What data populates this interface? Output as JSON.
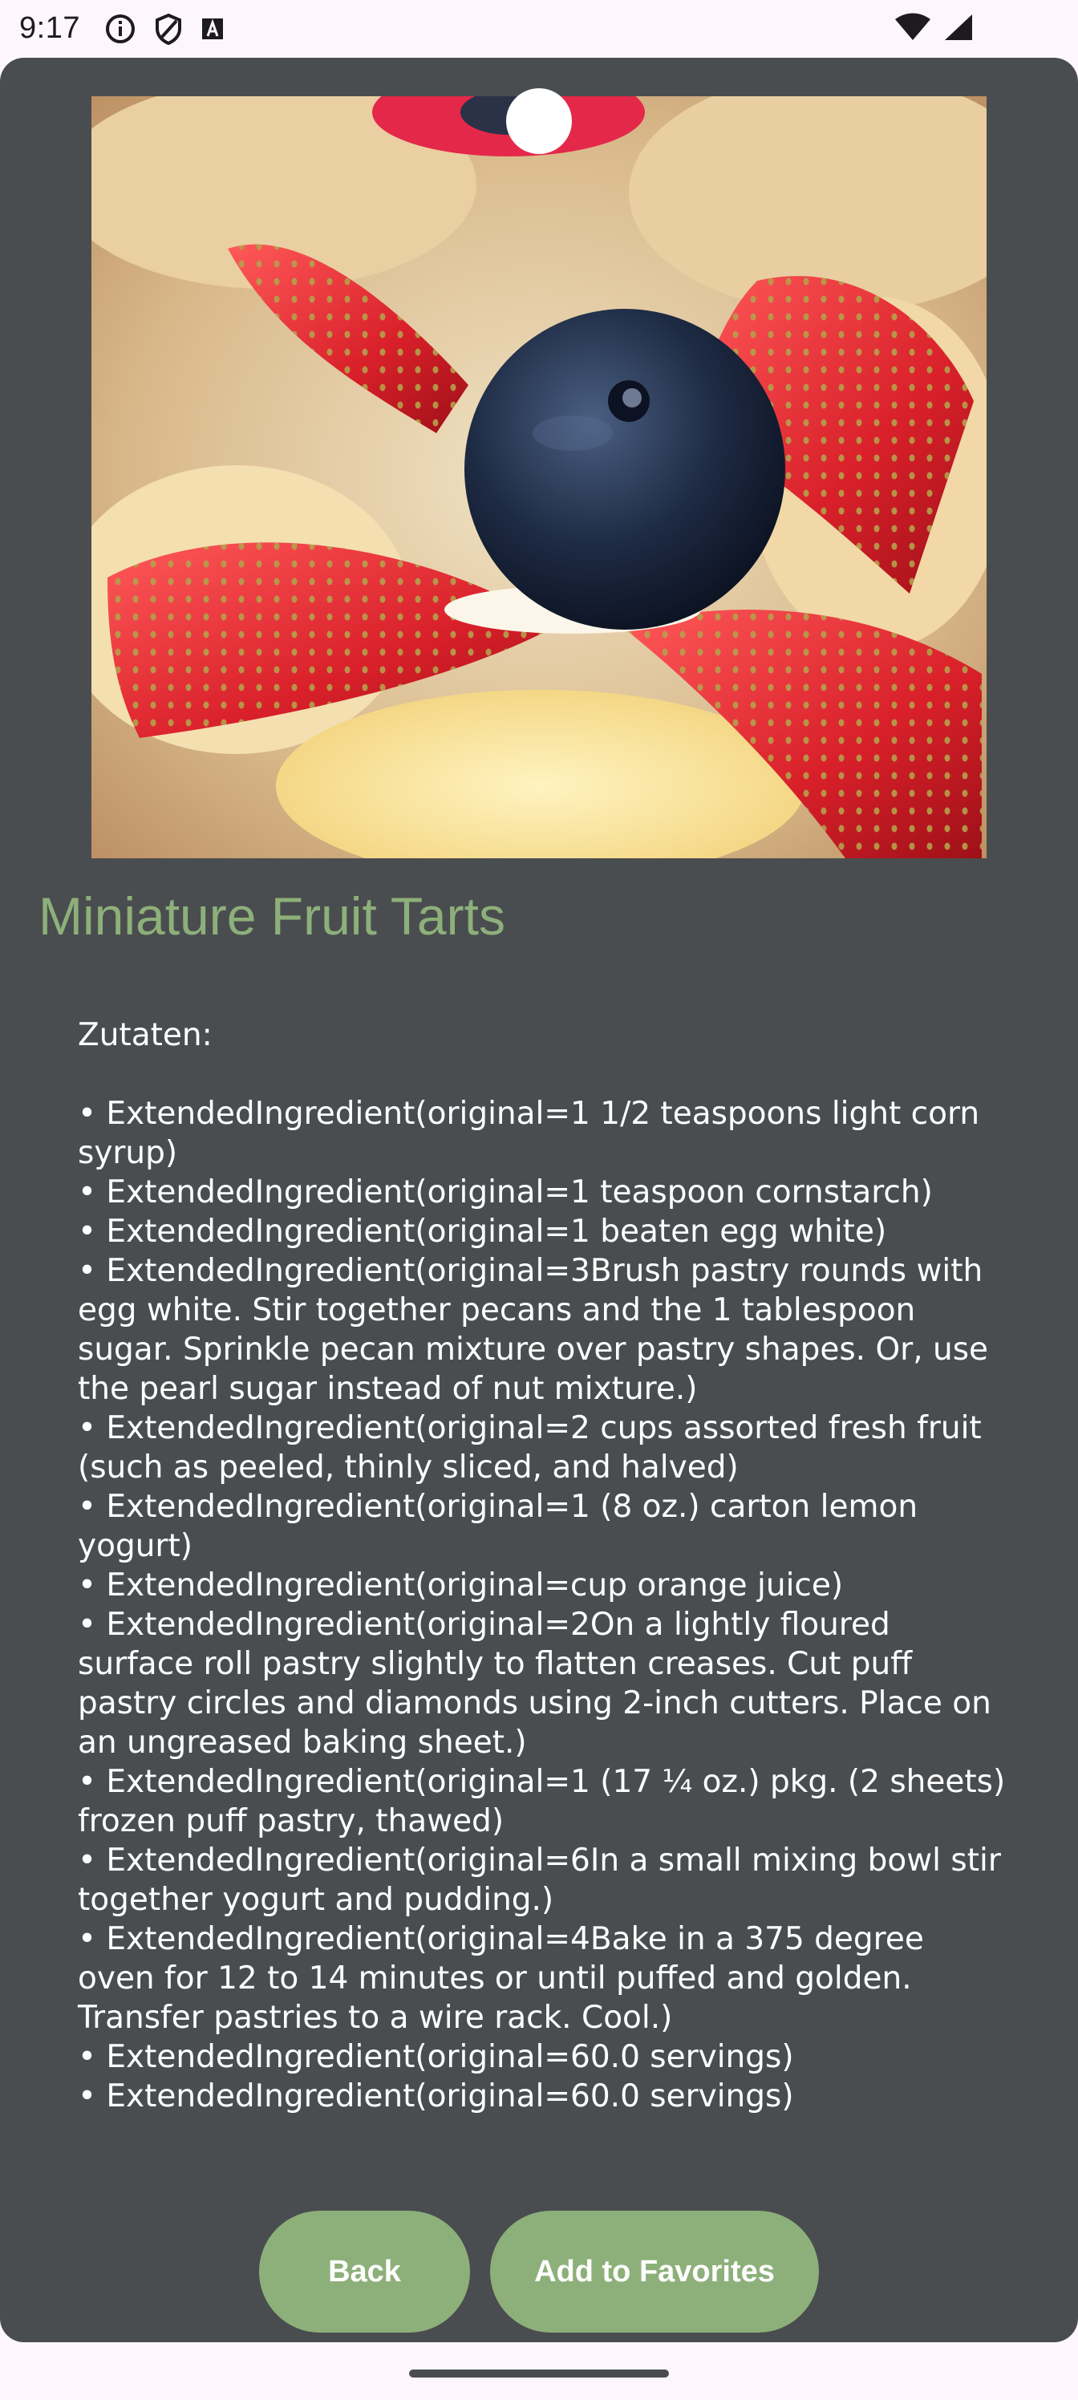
{
  "status_bar": {
    "time": "9:17",
    "icons_left": [
      "info-icon",
      "shield-icon",
      "keyboard-icon"
    ],
    "icons_right": [
      "wifi-icon",
      "signal-icon"
    ]
  },
  "recipe": {
    "title": "Miniature Fruit Tarts",
    "ingredients_heading": "Zutaten:",
    "ingredients": [
      "• ExtendedIngredient(original=1 1/2 teaspoons light corn syrup)",
      "• ExtendedIngredient(original=1 teaspoon cornstarch)",
      "• ExtendedIngredient(original=1 beaten egg white)",
      "• ExtendedIngredient(original=3Brush pastry rounds with egg white. Stir together pecans and the 1 tablespoon sugar. Sprinkle pecan mixture over pastry shapes. Or, use the pearl sugar instead of nut mixture.)",
      "• ExtendedIngredient(original=2 cups assorted fresh fruit (such as peeled, thinly sliced, and halved)",
      "• ExtendedIngredient(original=1 (8 oz.) carton lemon yogurt)",
      "• ExtendedIngredient(original=cup orange juice)",
      "• ExtendedIngredient(original=2On a lightly floured surface roll pastry slightly to flatten creases. Cut puff pastry circles and diamonds using 2-inch cutters. Place on an ungreased baking sheet.)",
      "• ExtendedIngredient(original=1 (17 ¼ oz.) pkg. (2 sheets) frozen puff pastry, thawed)",
      "• ExtendedIngredient(original=6In a small mixing bowl stir together yogurt and pudding.)",
      "• ExtendedIngredient(original=4Bake in a 375 degree oven for 12 to 14 minutes or until puffed and golden. Transfer pastries to a wire rack. Cool.)",
      "• ExtendedIngredient(original=60.0 servings)",
      "• ExtendedIngredient(original=60.0 servings)"
    ]
  },
  "buttons": {
    "back_label": "Back",
    "favorite_label": "Add to Favorites"
  },
  "colors": {
    "accent": "#8db07a",
    "background": "#4a4d4f",
    "text": "#ffffff"
  }
}
